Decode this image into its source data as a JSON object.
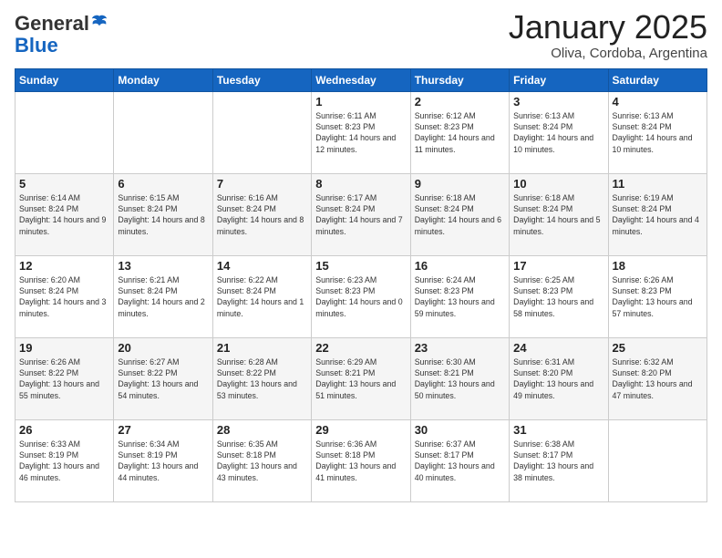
{
  "header": {
    "logo_general": "General",
    "logo_blue": "Blue",
    "month_title": "January 2025",
    "location": "Oliva, Cordoba, Argentina"
  },
  "weekdays": [
    "Sunday",
    "Monday",
    "Tuesday",
    "Wednesday",
    "Thursday",
    "Friday",
    "Saturday"
  ],
  "weeks": [
    [
      {
        "day": "",
        "info": ""
      },
      {
        "day": "",
        "info": ""
      },
      {
        "day": "",
        "info": ""
      },
      {
        "day": "1",
        "info": "Sunrise: 6:11 AM\nSunset: 8:23 PM\nDaylight: 14 hours and 12 minutes."
      },
      {
        "day": "2",
        "info": "Sunrise: 6:12 AM\nSunset: 8:23 PM\nDaylight: 14 hours and 11 minutes."
      },
      {
        "day": "3",
        "info": "Sunrise: 6:13 AM\nSunset: 8:24 PM\nDaylight: 14 hours and 10 minutes."
      },
      {
        "day": "4",
        "info": "Sunrise: 6:13 AM\nSunset: 8:24 PM\nDaylight: 14 hours and 10 minutes."
      }
    ],
    [
      {
        "day": "5",
        "info": "Sunrise: 6:14 AM\nSunset: 8:24 PM\nDaylight: 14 hours and 9 minutes."
      },
      {
        "day": "6",
        "info": "Sunrise: 6:15 AM\nSunset: 8:24 PM\nDaylight: 14 hours and 8 minutes."
      },
      {
        "day": "7",
        "info": "Sunrise: 6:16 AM\nSunset: 8:24 PM\nDaylight: 14 hours and 8 minutes."
      },
      {
        "day": "8",
        "info": "Sunrise: 6:17 AM\nSunset: 8:24 PM\nDaylight: 14 hours and 7 minutes."
      },
      {
        "day": "9",
        "info": "Sunrise: 6:18 AM\nSunset: 8:24 PM\nDaylight: 14 hours and 6 minutes."
      },
      {
        "day": "10",
        "info": "Sunrise: 6:18 AM\nSunset: 8:24 PM\nDaylight: 14 hours and 5 minutes."
      },
      {
        "day": "11",
        "info": "Sunrise: 6:19 AM\nSunset: 8:24 PM\nDaylight: 14 hours and 4 minutes."
      }
    ],
    [
      {
        "day": "12",
        "info": "Sunrise: 6:20 AM\nSunset: 8:24 PM\nDaylight: 14 hours and 3 minutes."
      },
      {
        "day": "13",
        "info": "Sunrise: 6:21 AM\nSunset: 8:24 PM\nDaylight: 14 hours and 2 minutes."
      },
      {
        "day": "14",
        "info": "Sunrise: 6:22 AM\nSunset: 8:24 PM\nDaylight: 14 hours and 1 minute."
      },
      {
        "day": "15",
        "info": "Sunrise: 6:23 AM\nSunset: 8:23 PM\nDaylight: 14 hours and 0 minutes."
      },
      {
        "day": "16",
        "info": "Sunrise: 6:24 AM\nSunset: 8:23 PM\nDaylight: 13 hours and 59 minutes."
      },
      {
        "day": "17",
        "info": "Sunrise: 6:25 AM\nSunset: 8:23 PM\nDaylight: 13 hours and 58 minutes."
      },
      {
        "day": "18",
        "info": "Sunrise: 6:26 AM\nSunset: 8:23 PM\nDaylight: 13 hours and 57 minutes."
      }
    ],
    [
      {
        "day": "19",
        "info": "Sunrise: 6:26 AM\nSunset: 8:22 PM\nDaylight: 13 hours and 55 minutes."
      },
      {
        "day": "20",
        "info": "Sunrise: 6:27 AM\nSunset: 8:22 PM\nDaylight: 13 hours and 54 minutes."
      },
      {
        "day": "21",
        "info": "Sunrise: 6:28 AM\nSunset: 8:22 PM\nDaylight: 13 hours and 53 minutes."
      },
      {
        "day": "22",
        "info": "Sunrise: 6:29 AM\nSunset: 8:21 PM\nDaylight: 13 hours and 51 minutes."
      },
      {
        "day": "23",
        "info": "Sunrise: 6:30 AM\nSunset: 8:21 PM\nDaylight: 13 hours and 50 minutes."
      },
      {
        "day": "24",
        "info": "Sunrise: 6:31 AM\nSunset: 8:20 PM\nDaylight: 13 hours and 49 minutes."
      },
      {
        "day": "25",
        "info": "Sunrise: 6:32 AM\nSunset: 8:20 PM\nDaylight: 13 hours and 47 minutes."
      }
    ],
    [
      {
        "day": "26",
        "info": "Sunrise: 6:33 AM\nSunset: 8:19 PM\nDaylight: 13 hours and 46 minutes."
      },
      {
        "day": "27",
        "info": "Sunrise: 6:34 AM\nSunset: 8:19 PM\nDaylight: 13 hours and 44 minutes."
      },
      {
        "day": "28",
        "info": "Sunrise: 6:35 AM\nSunset: 8:18 PM\nDaylight: 13 hours and 43 minutes."
      },
      {
        "day": "29",
        "info": "Sunrise: 6:36 AM\nSunset: 8:18 PM\nDaylight: 13 hours and 41 minutes."
      },
      {
        "day": "30",
        "info": "Sunrise: 6:37 AM\nSunset: 8:17 PM\nDaylight: 13 hours and 40 minutes."
      },
      {
        "day": "31",
        "info": "Sunrise: 6:38 AM\nSunset: 8:17 PM\nDaylight: 13 hours and 38 minutes."
      },
      {
        "day": "",
        "info": ""
      }
    ]
  ]
}
